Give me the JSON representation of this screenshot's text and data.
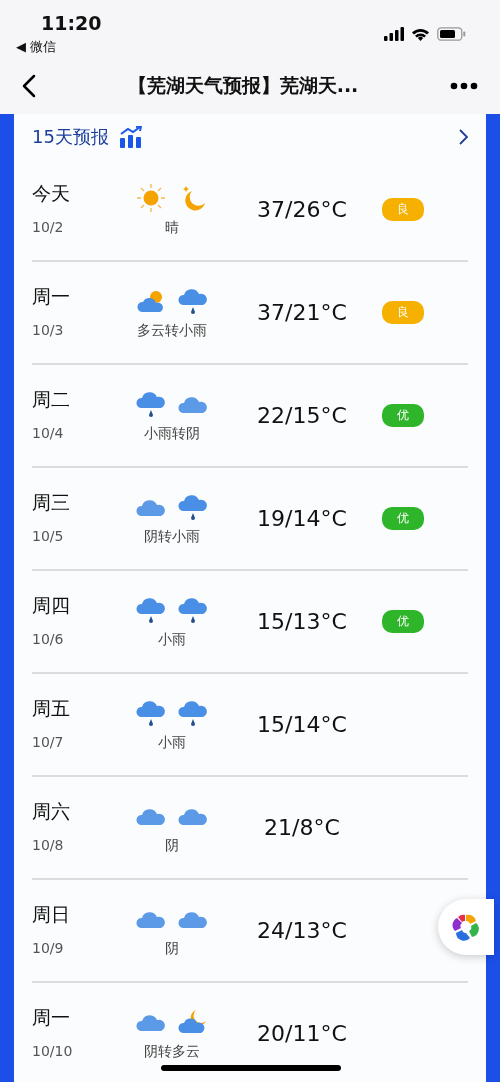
{
  "status_bar": {
    "time": "11:20",
    "back_app": "◀ 微信"
  },
  "nav": {
    "title": "【芜湖天气预报】芜湖天..."
  },
  "section": {
    "title": "15天预报"
  },
  "days": [
    {
      "day": "今天",
      "date": "10/2",
      "icons": [
        {
          "kind": "sun"
        },
        {
          "kind": "moon"
        }
      ],
      "condition": "晴",
      "temp": "37/26°C",
      "aqi": {
        "label": "良",
        "color": "#f5b000"
      }
    },
    {
      "day": "周一",
      "date": "10/3",
      "icons": [
        {
          "kind": "cloud-sun"
        },
        {
          "kind": "rain"
        }
      ],
      "condition": "多云转小雨",
      "temp": "37/21°C",
      "aqi": {
        "label": "良",
        "color": "#f5b000"
      }
    },
    {
      "day": "周二",
      "date": "10/4",
      "icons": [
        {
          "kind": "rain"
        },
        {
          "kind": "cloud"
        }
      ],
      "condition": "小雨转阴",
      "temp": "22/15°C",
      "aqi": {
        "label": "优",
        "color": "#2fb52a"
      }
    },
    {
      "day": "周三",
      "date": "10/5",
      "icons": [
        {
          "kind": "cloud"
        },
        {
          "kind": "rain"
        }
      ],
      "condition": "阴转小雨",
      "temp": "19/14°C",
      "aqi": {
        "label": "优",
        "color": "#2fb52a"
      }
    },
    {
      "day": "周四",
      "date": "10/6",
      "icons": [
        {
          "kind": "rain"
        },
        {
          "kind": "rain"
        }
      ],
      "condition": "小雨",
      "temp": "15/13°C",
      "aqi": {
        "label": "优",
        "color": "#2fb52a"
      }
    },
    {
      "day": "周五",
      "date": "10/7",
      "icons": [
        {
          "kind": "rain"
        },
        {
          "kind": "rain"
        }
      ],
      "condition": "小雨",
      "temp": "15/14°C"
    },
    {
      "day": "周六",
      "date": "10/8",
      "icons": [
        {
          "kind": "cloud"
        },
        {
          "kind": "cloud"
        }
      ],
      "condition": "阴",
      "temp": "21/8°C"
    },
    {
      "day": "周日",
      "date": "10/9",
      "icons": [
        {
          "kind": "cloud"
        },
        {
          "kind": "cloud"
        }
      ],
      "condition": "阴",
      "temp": "24/13°C"
    },
    {
      "day": "周一",
      "date": "10/10",
      "icons": [
        {
          "kind": "cloud"
        },
        {
          "kind": "moon-cloud"
        }
      ],
      "condition": "阴转多云",
      "temp": "20/11°C"
    }
  ]
}
